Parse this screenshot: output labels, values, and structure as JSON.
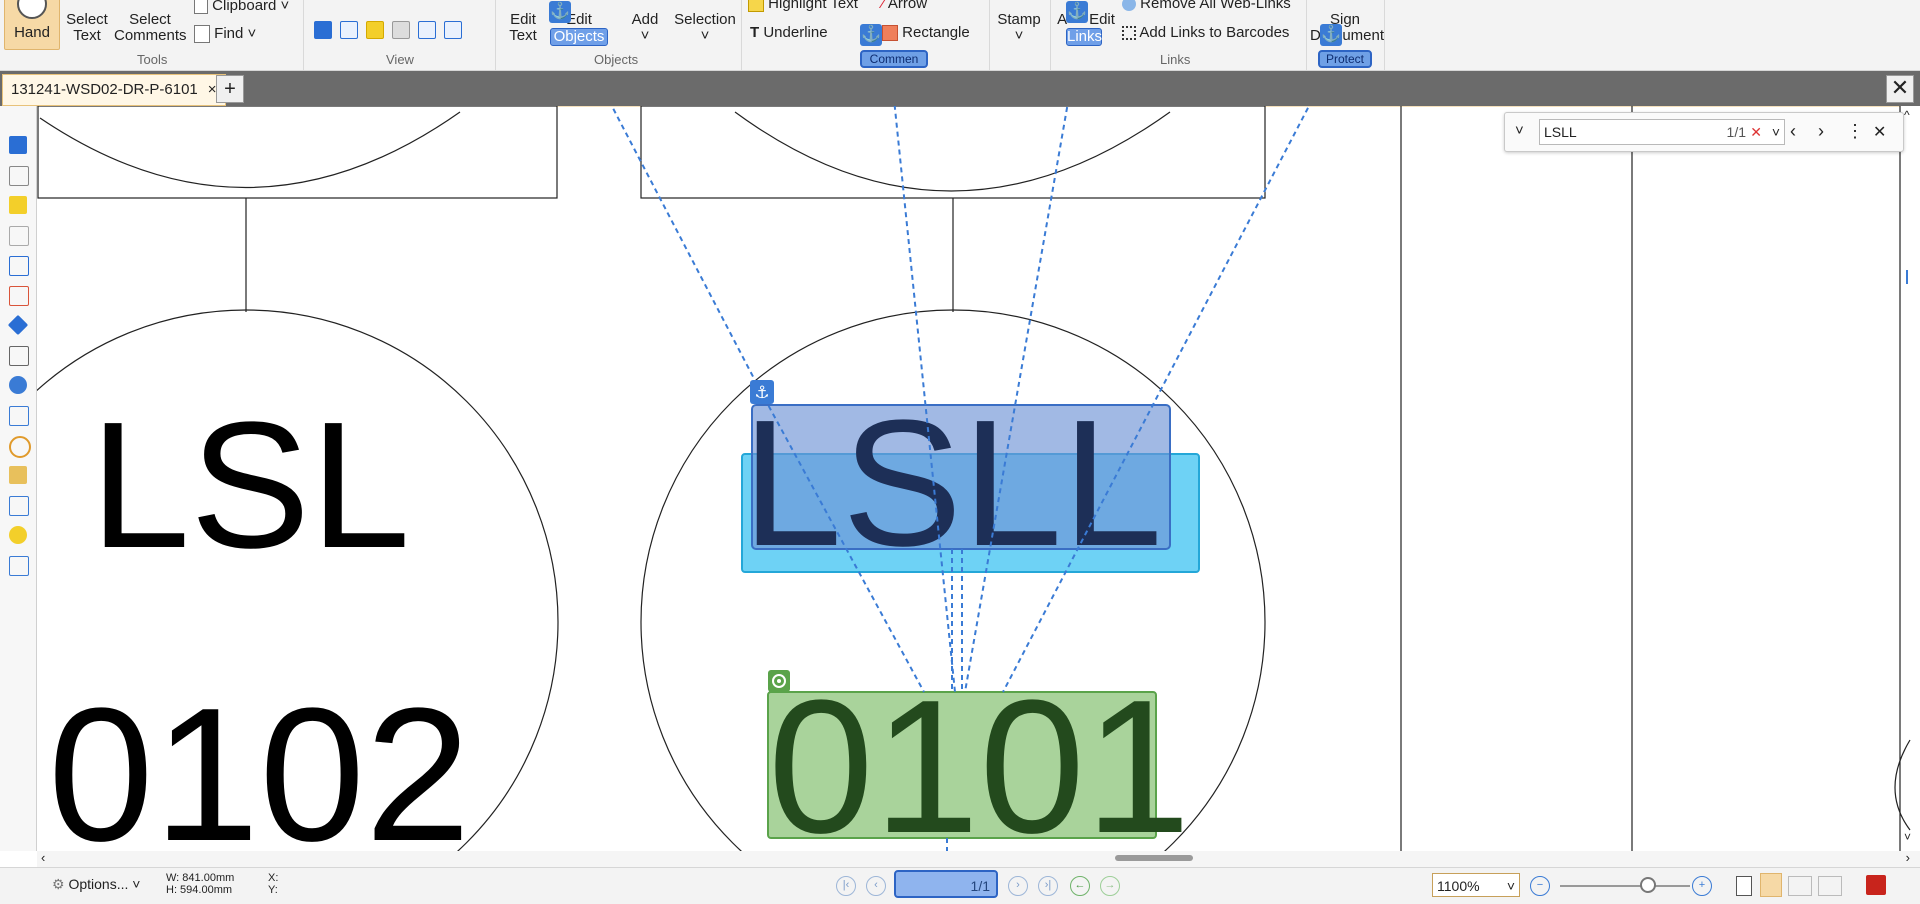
{
  "ribbon": {
    "hand_label": "Hand",
    "select_text": [
      "Select",
      "Text"
    ],
    "select_comments": [
      "Select",
      "Comments"
    ],
    "clipboard_label": "Clipboard",
    "find_label": "Find",
    "tools_group": "Tools",
    "view_group": "View",
    "edit_text": [
      "Edit",
      "Text"
    ],
    "edit_objects": [
      "Edit",
      "Objects"
    ],
    "add_label": "Add",
    "selection_label": "Selection",
    "objects_group": "Objects",
    "highlight_text": "Highlight Text",
    "arrow_label": "Arrow",
    "underline_label": "Underline",
    "rectangle_label": "Rectangle",
    "comment_group": "Commen",
    "stamp_label": "Stamp",
    "edit_links": [
      "A",
      "Edit",
      "Links"
    ],
    "remove_web_links": "Remove All Web-Links",
    "add_links_barcodes": "Add Links to Barcodes",
    "links_group": "Links",
    "sign_document": [
      "Sign",
      "D",
      "cument"
    ],
    "protect_group": "Protect"
  },
  "tabs": {
    "doc_tab": "131241-WSD02-DR-P-6101",
    "close_glyph": "×",
    "add_glyph": "+",
    "close_all_glyph": "✕"
  },
  "find": {
    "query": "LSLL",
    "count": "1/1"
  },
  "drawing": {
    "left_top": "LSL",
    "left_bottom": "0102",
    "center_top": "LSLL",
    "center_bottom": "0101"
  },
  "status": {
    "options_label": "Options...",
    "width_label": "W: 841.00mm",
    "height_label": "H: 594.00mm",
    "x_label": "X:",
    "y_label": "Y:",
    "page_value": "1/1",
    "zoom_value": "1100%"
  },
  "colors": {
    "anchor_blue": "#3a7bd5",
    "highlight_blue": "#6f93d6",
    "cyan_box": "#3dc3f2",
    "green_box": "#8cc47a",
    "text_dark": "#1d2f57"
  }
}
